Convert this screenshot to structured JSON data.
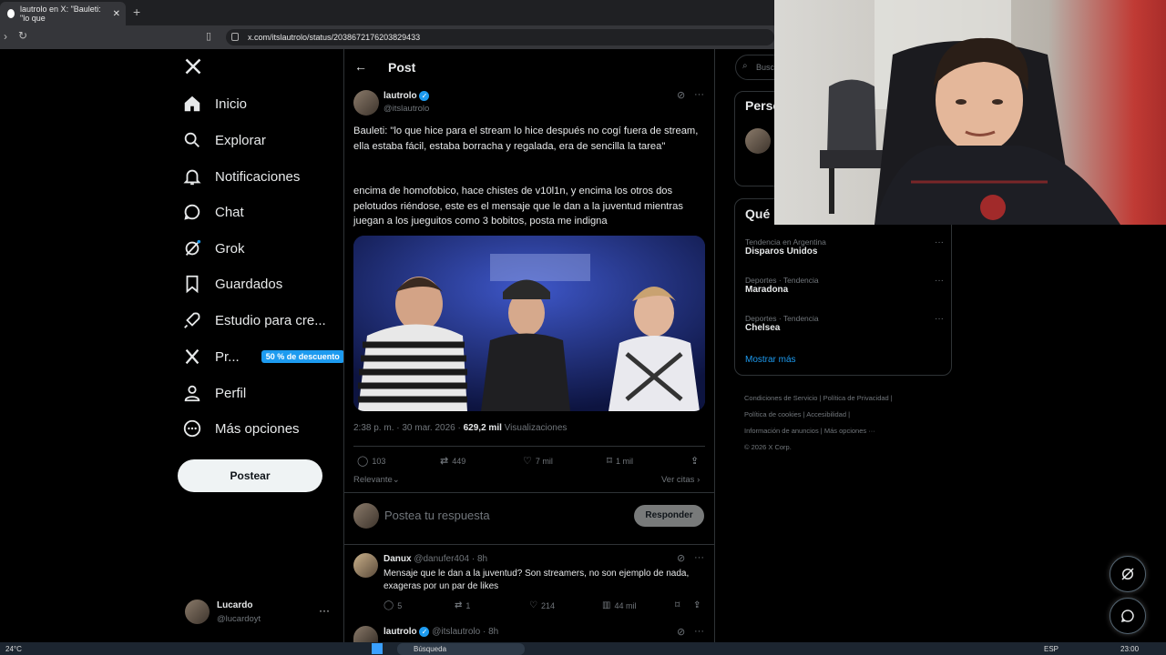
{
  "browser": {
    "tab_title": "lautrolo en X: \"Bauleti: \"lo que",
    "url": "x.com/itslautrolo/status/2038672176203829433"
  },
  "nav": {
    "items": [
      {
        "label": "Inicio",
        "icon": "home-icon"
      },
      {
        "label": "Explorar",
        "icon": "search-icon"
      },
      {
        "label": "Notificaciones",
        "icon": "bell-icon"
      },
      {
        "label": "Chat",
        "icon": "chat-icon"
      },
      {
        "label": "Grok",
        "icon": "grok-icon"
      },
      {
        "label": "Guardados",
        "icon": "bookmark-icon"
      },
      {
        "label": "Estudio para cre...",
        "icon": "rocket-icon"
      },
      {
        "label": "Pr...",
        "icon": "x-premium-icon"
      },
      {
        "label": "Perfil",
        "icon": "person-icon"
      },
      {
        "label": "Más opciones",
        "icon": "more-circle-icon"
      }
    ],
    "premium_badge": "50 % de descuento",
    "post_button": "Postear",
    "account": {
      "name": "Lucardo",
      "handle": "@lucardoyt"
    }
  },
  "header": {
    "title": "Post"
  },
  "tweet": {
    "author": "lautrolo",
    "handle": "@itslautrolo",
    "text_1": "Bauleti: \"lo que hice para el stream lo hice después no cogí fuera de stream, ella estaba fácil, estaba borracha y regalada, era de sencilla la tarea\"",
    "text_2": "encima de homofobico, hace chistes de v10l1n, y encima los otros dos pelotudos riéndose, este es el mensaje que le dan a la juventud mientras juegan a los jueguitos como 3 bobitos, posta me indigna",
    "time": "2:38 p. m. · 30 mar. 2026 · ",
    "views": "629,2 mil",
    "views_label": "Visualizaciones",
    "replies": "103",
    "reposts": "449",
    "likes": "7 mil",
    "bookmarks": "1 mil",
    "sort": "Relevante",
    "quotes": "Ver citas"
  },
  "reply_box": {
    "placeholder": "Postea tu respuesta",
    "button": "Responder"
  },
  "replies": [
    {
      "author": "Danux",
      "handle": "@danufer404 · 8h",
      "text": "Mensaje que le dan a la juventud? Son streamers, no son ejemplo de nada, exageras por un par de likes",
      "replies": "5",
      "reposts": "1",
      "likes": "214",
      "views": "44 mil"
    },
    {
      "author": "lautrolo",
      "handle": "@itslautrolo · 8h"
    }
  ],
  "right": {
    "search_placeholder": "Busc",
    "people_title": "Perso",
    "trends_title": "Qué",
    "trends": [
      {
        "category": "Tendencia en Argentina",
        "name": "Disparos Unidos"
      },
      {
        "category": "Deportes · Tendencia",
        "name": "Maradona"
      },
      {
        "category": "Deportes · Tendencia",
        "name": "Chelsea"
      }
    ],
    "show_more": "Mostrar más",
    "footer": [
      "Condiciones de Servicio",
      "Política de Privacidad",
      "Política de cookies",
      "Accesibilidad",
      "Información de anuncios",
      "Más opciones ···",
      "© 2026 X Corp."
    ]
  },
  "taskbar": {
    "weather": "24°C",
    "search": "Búsqueda",
    "lang": "ESP",
    "clock": "23:00"
  }
}
